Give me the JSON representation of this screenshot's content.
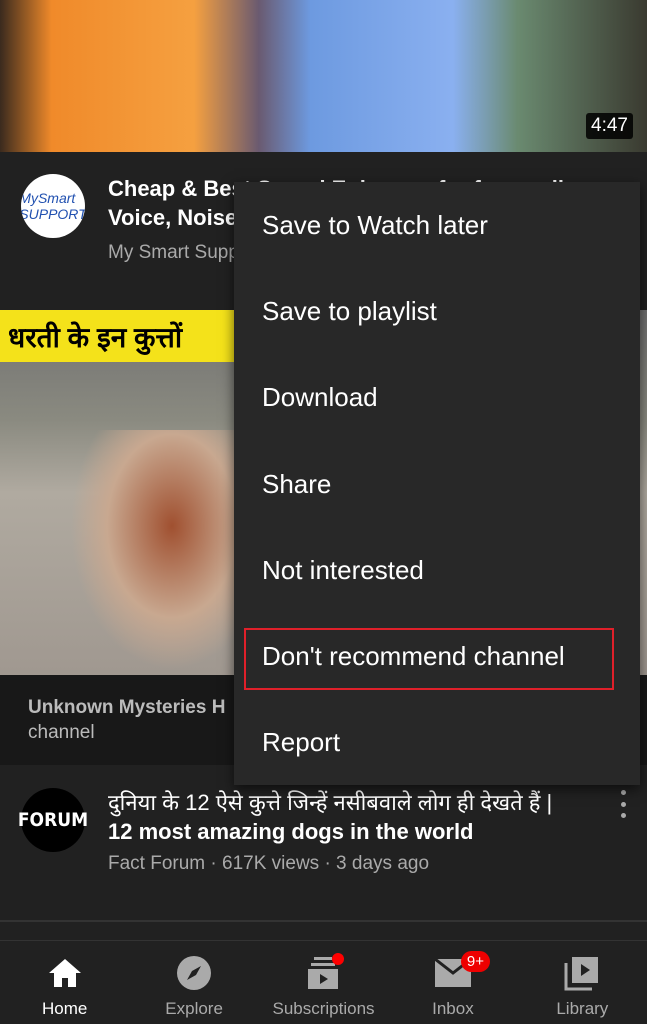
{
  "videos": [
    {
      "title_line1": "Cheap & Best Sound Enhancer for four walls",
      "title_line2": "Voice, Noise",
      "channel_meta": "My Smart Support",
      "duration": "4:47",
      "avatar_text": "MySmart SUPPORT"
    },
    {
      "banner_text": "धरती के इन कुत्तों",
      "channel_overlay_line1": "Unknown Mysteries H",
      "channel_overlay_line2": "channel"
    },
    {
      "title_line1": "दुनिया के 12 ऐसे कुत्ते जिन्हें नसीबवाले लोग ही देखते हैं |",
      "title_line2": "12 most amazing dogs in the world",
      "meta": "Fact Forum · 617K views · 3 days ago",
      "avatar_text": "FORUM"
    }
  ],
  "menu": {
    "items": [
      "Save to Watch later",
      "Save to playlist",
      "Download",
      "Share",
      "Not interested",
      "Don't recommend channel",
      "Report"
    ],
    "highlighted": "Don't recommend channel",
    "highlight_color": "#e0202a"
  },
  "nav": {
    "items": [
      {
        "label": "Home",
        "icon": "home-icon",
        "active": true
      },
      {
        "label": "Explore",
        "icon": "compass-icon"
      },
      {
        "label": "Subscriptions",
        "icon": "subscriptions-icon",
        "dot": true
      },
      {
        "label": "Inbox",
        "icon": "mail-icon",
        "badge": "9+"
      },
      {
        "label": "Library",
        "icon": "library-icon"
      }
    ]
  }
}
